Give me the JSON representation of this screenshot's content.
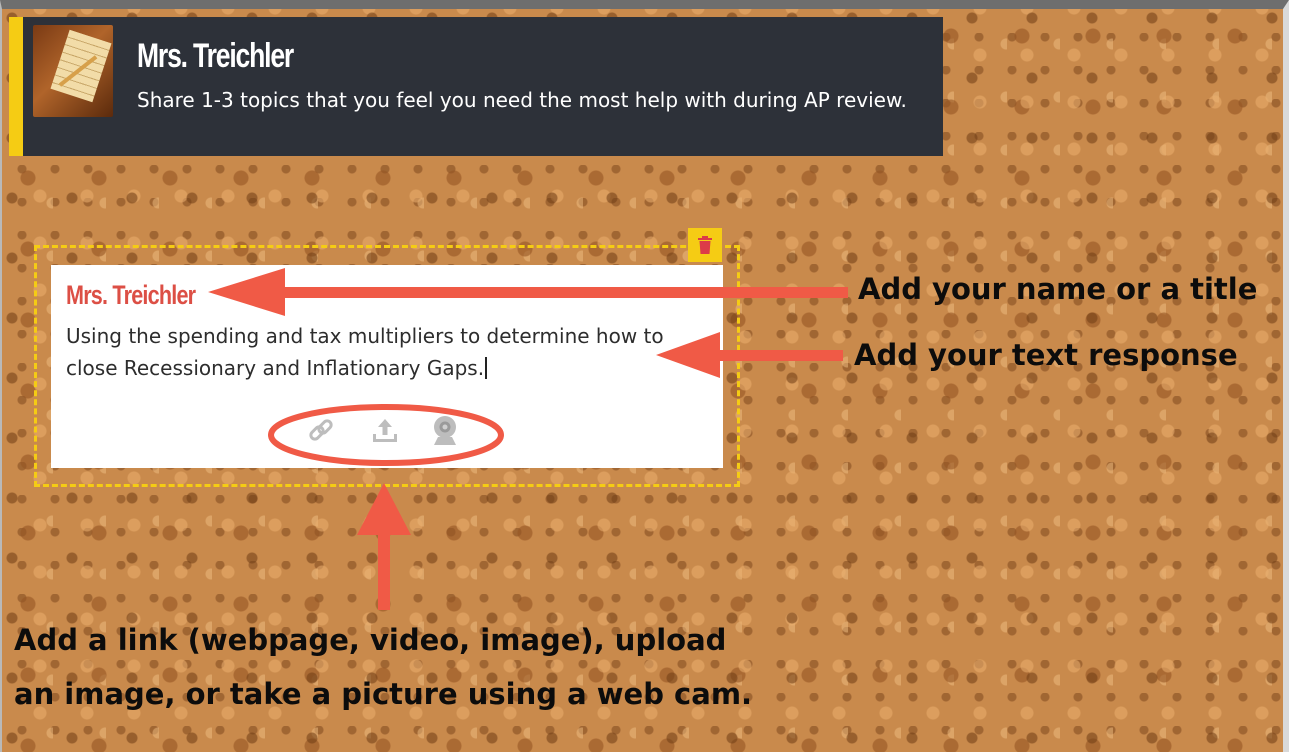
{
  "header": {
    "title": "Mrs. Treichler",
    "description": "Share 1-3 topics that you feel you need the most help with during AP review."
  },
  "post": {
    "title": "Mrs. Treichler",
    "body": "Using the spending and tax multipliers to determine how to close Recessionary and Inflationary Gaps.",
    "attachments": [
      {
        "icon": "link-icon"
      },
      {
        "icon": "upload-icon"
      },
      {
        "icon": "webcam-icon"
      }
    ],
    "delete_icon": "trash-icon"
  },
  "annotations": {
    "name": "Add your name or a title",
    "text": "Add your text response",
    "attach_line1": "Add a link (webpage, video, image), upload",
    "attach_line2": "an image, or take a picture using a web cam."
  },
  "colors": {
    "accent": "#f5cc14",
    "header_bg": "#2d3139",
    "title_red": "#dc4f45",
    "annotation_red": "#f05a46",
    "cork": "#c98a4c"
  }
}
